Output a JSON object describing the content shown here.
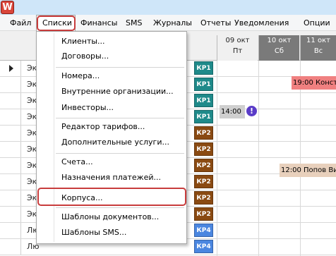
{
  "titlebar": {
    "app_icon_glyph": "W",
    "icon": "app-logo-icon"
  },
  "menubar": {
    "items": [
      {
        "label": "Файл"
      },
      {
        "label": "Списки"
      },
      {
        "label": "Финансы"
      },
      {
        "label": "SMS"
      },
      {
        "label": "Журналы"
      },
      {
        "label": "Отчеты"
      },
      {
        "label": "Уведомления"
      },
      {
        "label": "Опции"
      }
    ]
  },
  "dropdown": {
    "items": [
      {
        "label": "Клиенты..."
      },
      {
        "label": "Договоры..."
      },
      {
        "label": "Номера..."
      },
      {
        "label": "Внутренние организации..."
      },
      {
        "label": "Инвесторы..."
      },
      {
        "label": "Редактор тарифов..."
      },
      {
        "label": "Дополнительные услуги..."
      },
      {
        "label": "Счета..."
      },
      {
        "label": "Назначения платежей..."
      },
      {
        "label": "Корпуса..."
      },
      {
        "label": "Шаблоны документов..."
      },
      {
        "label": "Шаблоны SMS..."
      }
    ]
  },
  "calendar": {
    "days": [
      {
        "date": "09 окт",
        "weekday": "Пт",
        "weekend": false
      },
      {
        "date": "10 окт",
        "weekday": "Сб",
        "weekend": true
      },
      {
        "date": "11 окт",
        "weekday": "Вс",
        "weekend": true
      }
    ]
  },
  "rows": [
    {
      "name": "Эк",
      "room": "КР1"
    },
    {
      "name": "Эк",
      "room": "КР1"
    },
    {
      "name": "Эк",
      "room": "КР1"
    },
    {
      "name": "Эк",
      "room": "КР1"
    },
    {
      "name": "Эк",
      "room": "КР2"
    },
    {
      "name": "Эк",
      "room": "КР2"
    },
    {
      "name": "Эк",
      "room": "КР2"
    },
    {
      "name": "Эк",
      "room": "КР2"
    },
    {
      "name": "Эк",
      "room": "КР2"
    },
    {
      "name": "Эк",
      "room": "КР2"
    },
    {
      "name": "Лю",
      "room": "КР4"
    },
    {
      "name": "Лю",
      "room": "КР4"
    }
  ],
  "bookings": [
    {
      "text": "19:00 Конст",
      "color": "#f08080"
    },
    {
      "text": "14:00",
      "color": "#cfcfcf"
    },
    {
      "text": "12:00 Попов Ви",
      "color": "#e8d0bc"
    }
  ],
  "alert_icon": {
    "glyph": "!",
    "icon": "alert-icon"
  },
  "colors": {
    "kp1": "#1f8a8a",
    "kp2": "#8a4a12",
    "kp4": "#4a86e0",
    "highlight": "#c83c3c",
    "weekend_header": "#7a7a7a"
  }
}
